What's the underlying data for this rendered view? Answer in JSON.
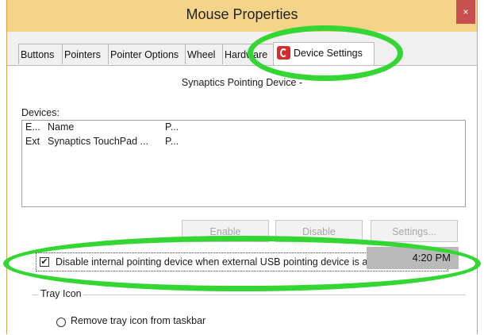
{
  "window": {
    "title": "Mouse Properties",
    "close_glyph": "×"
  },
  "tabs": [
    {
      "label": "Buttons"
    },
    {
      "label": "Pointers"
    },
    {
      "label": "Pointer Options"
    },
    {
      "label": "Wheel"
    },
    {
      "label": "Hardware"
    },
    {
      "label": "Device Settings",
      "icon": "synaptics-icon"
    }
  ],
  "panel": {
    "device_name": "Synaptics Pointing Device -",
    "devices_label": "Devices:",
    "columns": {
      "enabled": "E...",
      "name": "Name",
      "port": "P..."
    },
    "rows": [
      {
        "enabled": "Ext",
        "name": "Synaptics TouchPad ...",
        "port": "P..."
      }
    ],
    "buttons": {
      "enable": "Enable",
      "disable": "Disable",
      "settings": "Settings..."
    },
    "checkbox": {
      "checked": true,
      "mark": "✔",
      "label": "Disable internal pointing device when external USB pointing device is attached"
    },
    "tray_group": {
      "label": "Tray Icon",
      "radio_label": "Remove tray icon from taskbar"
    }
  },
  "taskbar": {
    "clock": "4:20 PM"
  },
  "colors": {
    "title_bar": "#f4d488",
    "highlight": "#33d633",
    "close": "#c75050"
  }
}
